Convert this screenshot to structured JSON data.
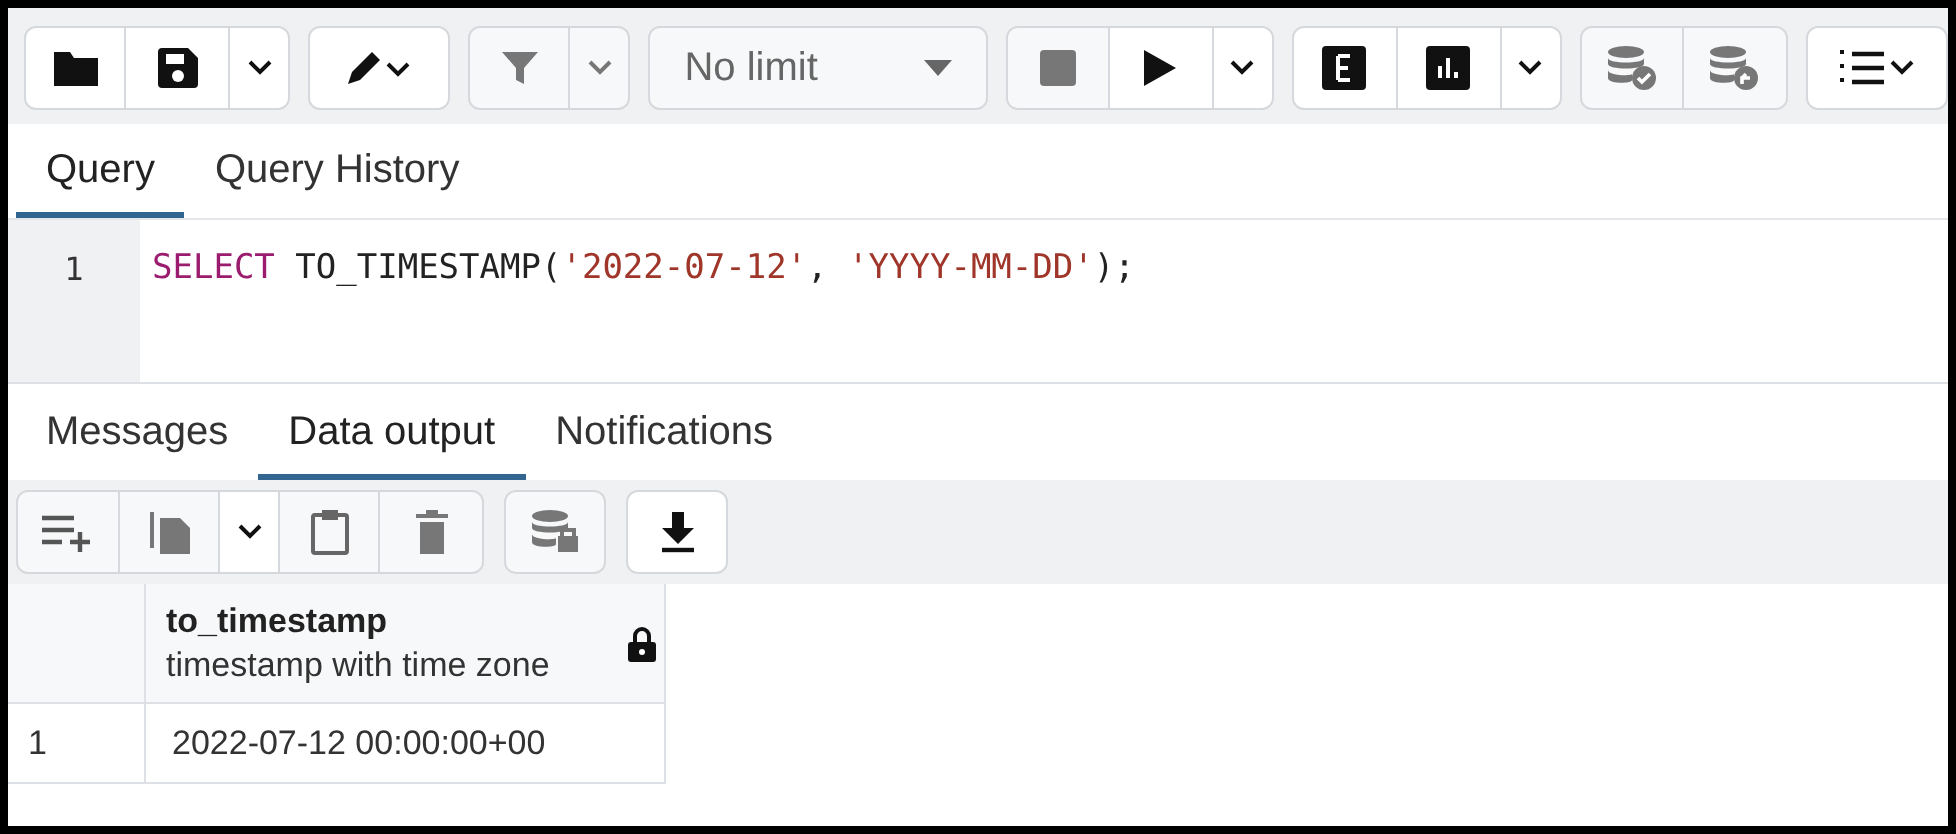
{
  "toolbar": {
    "row_limit": "No limit"
  },
  "editor_tabs": [
    {
      "label": "Query",
      "selected": true
    },
    {
      "label": "Query History",
      "selected": false
    }
  ],
  "editor": {
    "lines": [
      {
        "number": "1",
        "tokens": [
          {
            "kind": "keyword",
            "text": "SELECT"
          },
          {
            "kind": "plain",
            "text": " TO_TIMESTAMP("
          },
          {
            "kind": "string",
            "text": "'2022-07-12'"
          },
          {
            "kind": "plain",
            "text": ", "
          },
          {
            "kind": "string",
            "text": "'YYYY-MM-DD'"
          },
          {
            "kind": "plain",
            "text": ");"
          }
        ]
      }
    ]
  },
  "output_tabs": [
    {
      "label": "Messages",
      "selected": false
    },
    {
      "label": "Data output",
      "selected": true
    },
    {
      "label": "Notifications",
      "selected": false
    }
  ],
  "table": {
    "columns": [
      {
        "name": "to_timestamp",
        "type": "timestamp with time zone",
        "locked": true
      }
    ],
    "rows": [
      {
        "number": "1",
        "cells": [
          "2022-07-12 00:00:00+00"
        ]
      }
    ]
  }
}
